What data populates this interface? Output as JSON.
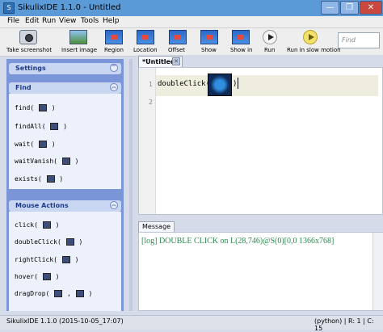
{
  "window": {
    "title": "SikulixIDE 1.1.0 - Untitled",
    "icon_letter": "S"
  },
  "titlebar_buttons": {
    "minimize": "—",
    "maximize": "❐",
    "close": "✕"
  },
  "menu": [
    "File",
    "Edit",
    "Run",
    "View",
    "Tools",
    "Help"
  ],
  "toolbar": {
    "buttons": [
      {
        "label": "Take screenshot",
        "icon": "camera-icon"
      },
      {
        "label": "Insert image",
        "icon": "insert-image-icon"
      },
      {
        "label": "Region",
        "icon": "region-icon"
      },
      {
        "label": "Location",
        "icon": "location-icon"
      },
      {
        "label": "Offset",
        "icon": "offset-icon"
      },
      {
        "label": "Show",
        "icon": "show-icon"
      },
      {
        "label": "Show in",
        "icon": "show-in-icon"
      },
      {
        "label": "Run",
        "icon": "run-icon"
      },
      {
        "label": "Run in slow motion",
        "icon": "slow-motion-icon"
      }
    ],
    "search_placeholder": "Find"
  },
  "sidebar": {
    "settings_label": "Settings",
    "find_label": "Find",
    "find_items": [
      "find(",
      "findAll(",
      "wait(",
      "waitVanish(",
      "exists("
    ],
    "mouse_label": "Mouse Actions",
    "mouse_items": [
      "click(",
      "doubleClick(",
      "rightClick(",
      "hover(",
      "dragDrop("
    ],
    "item_close": ")",
    "dragdrop_sep": ",",
    "chev_up": "︽",
    "chev_down": "︾"
  },
  "editor": {
    "tab_label": "*Untitled",
    "tab_close": "✕",
    "line_numbers": [
      "1",
      "2"
    ],
    "code_call": "doubleClick(",
    "code_close": ")"
  },
  "message": {
    "tab_label": "Message",
    "log": "[log] DOUBLE CLICK on L(28,746)@S(0)[0,0 1366x768]"
  },
  "status": {
    "left": "SikulixIDE 1.1.0 (2015-10-05_17:07)",
    "right": "(python) | R: 1 | C: 15"
  },
  "colors": {
    "titlebar": "#5a9ad6",
    "sidebar": "#7a96d8",
    "log_text": "#2b8a4f"
  }
}
